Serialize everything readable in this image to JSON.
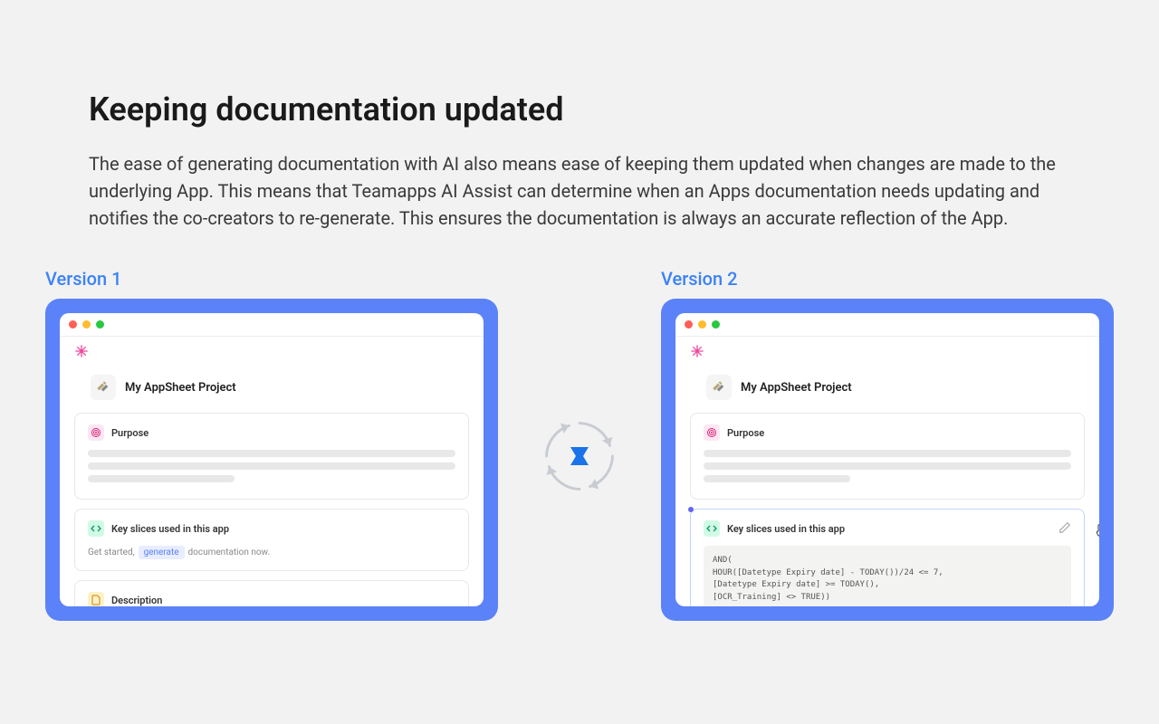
{
  "heading": "Keeping documentation updated",
  "body": "The ease of generating documentation with AI also means ease of keeping them updated when changes are made to the underlying App. This means that Teamapps AI Assist can determine when an Apps documentation needs updating and notifies the co-creators to re-generate. This ensures the documentation is always an accurate reflection of the App.",
  "v1": {
    "label": "Version 1",
    "project_title": "My AppSheet Project",
    "purpose_title": "Purpose",
    "slices_title": "Key slices used in this app",
    "gen_prefix": "Get started,",
    "gen_link": "generate",
    "gen_suffix": "documentation now.",
    "desc_title": "Description"
  },
  "v2": {
    "label": "Version 2",
    "project_title": "My AppSheet Project",
    "purpose_title": "Purpose",
    "slices_title": "Key slices used in this app",
    "code": "AND(\nHOUR([Datetype Expiry date] - TODAY())/24 <= 7,\n[Datetype Expiry date] >= TODAY(),\n[OCR_Training] <> TRUE))"
  }
}
